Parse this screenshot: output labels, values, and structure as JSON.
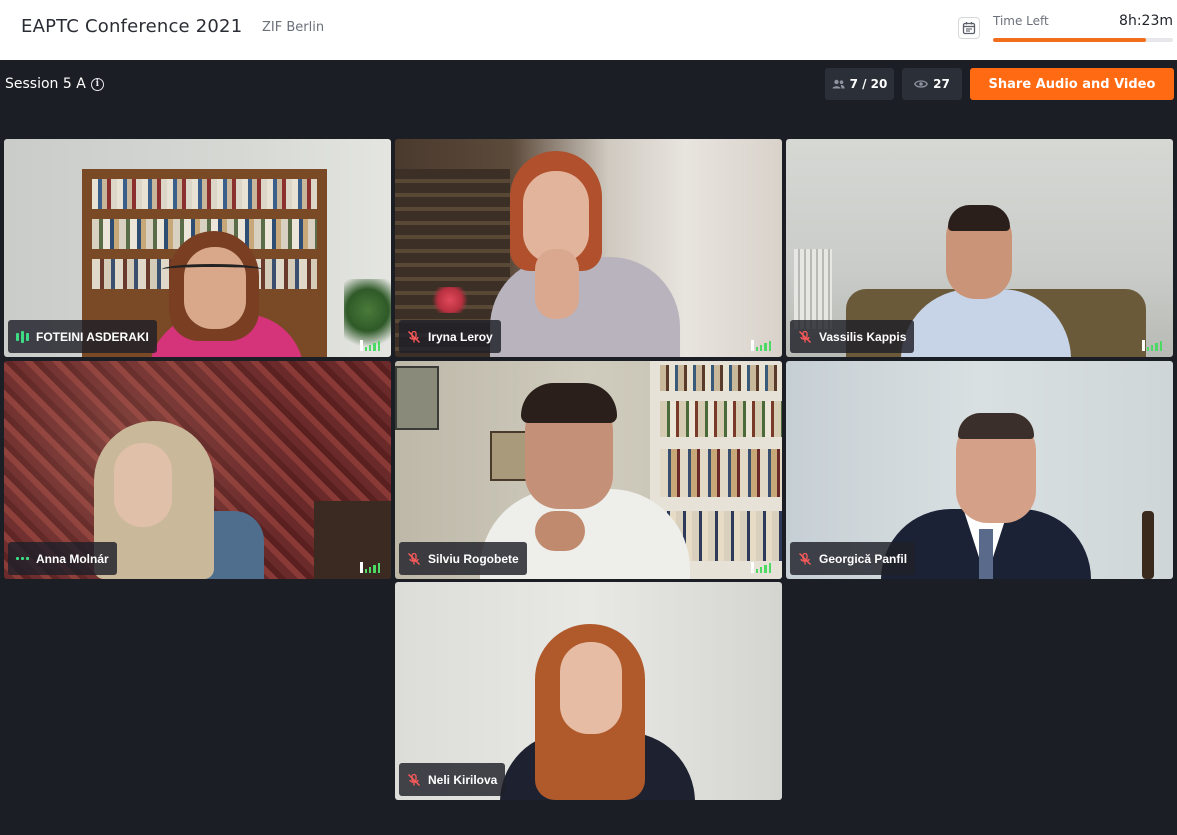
{
  "header": {
    "event_title": "EAPTC Conference 2021",
    "venue": "ZIF Berlin",
    "time_left_label": "Time Left",
    "time_left_value": "8h:23m",
    "time_left_fraction": 0.85,
    "calendar_icon": "calendar-icon"
  },
  "session": {
    "name": "Session 5 A",
    "info_icon": "info-icon",
    "participants": "7 / 20",
    "viewers": "27",
    "share_label": "Share Audio and Video"
  },
  "colors": {
    "accent": "#ff6a13",
    "background": "#1c1e25",
    "speaking": "#3ddc84",
    "muted": "#ff5a5a"
  },
  "participants": [
    {
      "name": "FOTEINI ASDERAKI",
      "status": "speaking"
    },
    {
      "name": "Iryna Leroy",
      "status": "muted"
    },
    {
      "name": "Vassilis Kappis",
      "status": "muted"
    },
    {
      "name": "Anna Molnár",
      "status": "audio-idle"
    },
    {
      "name": "Silviu Rogobete",
      "status": "muted"
    },
    {
      "name": "Georgică Panfil",
      "status": "muted"
    },
    {
      "name": "Neli Kirilova",
      "status": "muted"
    }
  ]
}
